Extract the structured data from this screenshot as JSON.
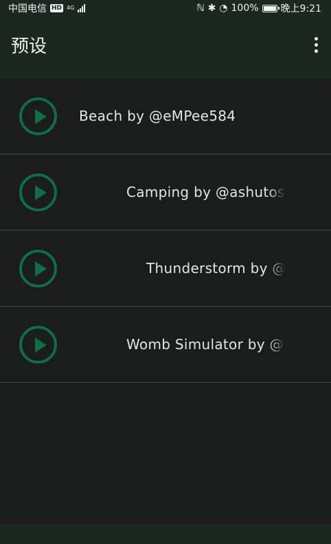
{
  "status_bar": {
    "carrier": "中国电信",
    "hd": "HD",
    "network": "4G",
    "battery_percent": "100%",
    "battery_level": 1.0,
    "time": "晚上9:21",
    "icons": [
      "nfc-icon",
      "bluetooth-icon",
      "data-saver-icon",
      "battery-icon",
      "signal-icon"
    ]
  },
  "app_bar": {
    "title": "预设",
    "menu_icon": "more-vert-icon"
  },
  "presets": [
    {
      "label": "Beach by @eMPee584"
    },
    {
      "label": "Camping by @ashutos"
    },
    {
      "label": "Thunderstorm by @"
    },
    {
      "label": "Womb Simulator by @"
    }
  ],
  "colors": {
    "accent": "#0f6d48",
    "app_bar_bg": "#1c2722",
    "background": "#1b1c1c",
    "divider": "#4a4b4b"
  }
}
